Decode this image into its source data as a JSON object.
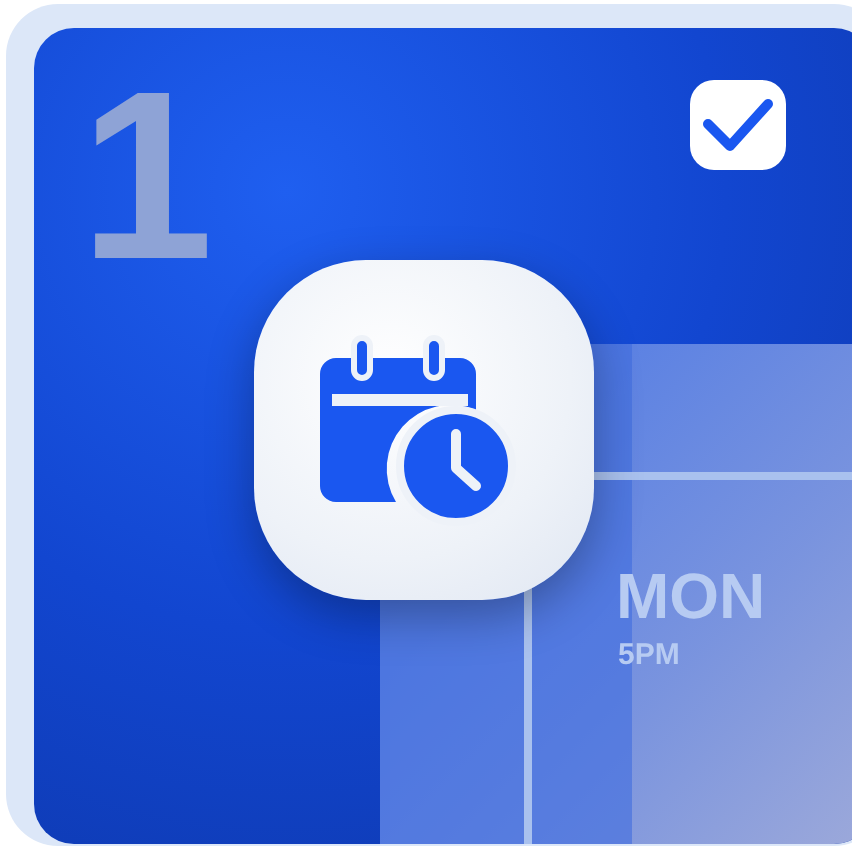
{
  "day_number": "1",
  "checkbox": {
    "checked": true
  },
  "calendar_cell": {
    "day": "MON",
    "time": "5PM"
  }
}
